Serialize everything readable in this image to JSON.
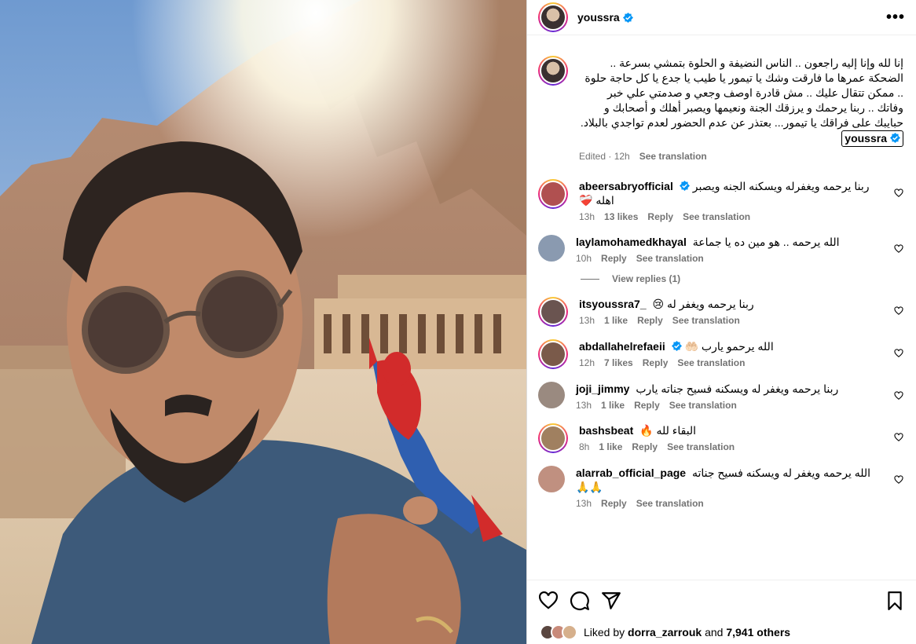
{
  "post": {
    "username": "youssra",
    "caption_username": "youssra",
    "caption_text": "إنا لله وإنا إليه راجعون .. الناس النضيفة و الحلوة بتمشي بسرعة .. الضحكة عمرها ما فارقت وشك يا تيمور يا طيب يا جدع يا كل حاجة حلوة .. ممكن تتقال عليك .. مش قادرة اوصف وجعي و صدمتي علي خبر وفاتك .. ربنا يرحمك و يرزقك الجنة ونعيمها ويصبر أهلك و أصحابك و حبايبك على فراقك يا تيمور... بعتذر عن عدم الحضور لعدم تواجدي بالبلاد.",
    "caption_time": "Edited · 12h",
    "see_translation": "See translation"
  },
  "comments": [
    {
      "user": "abeersabryofficial",
      "verified": true,
      "text": "ربنا يرحمه ويغفرله ويسكنه الجنه ويصبر اهله ❤️‍🩹",
      "time": "13h",
      "likes": "13 likes",
      "reply": "Reply",
      "translate": "See translation",
      "ring": true
    },
    {
      "user": "laylamohamedkhayal",
      "verified": false,
      "text": "الله يرحمه .. هو مين ده يا جماعة",
      "time": "10h",
      "likes": "",
      "reply": "Reply",
      "translate": "See translation",
      "ring": false
    },
    {
      "user": "itsyoussra7_",
      "verified": false,
      "text": "ربنا يرحمه ويغفر له 😢",
      "time": "13h",
      "likes": "1 like",
      "reply": "Reply",
      "translate": "See translation",
      "ring": true
    },
    {
      "user": "abdallahelrefaeii",
      "verified": true,
      "text": "الله يرحمو يارب 🤲🏻",
      "time": "12h",
      "likes": "7 likes",
      "reply": "Reply",
      "translate": "See translation",
      "ring": true
    },
    {
      "user": "joji_jimmy",
      "verified": false,
      "text": "ربنا يرحمه ويغفر له ويسكنه فسيح جناته يارب",
      "time": "13h",
      "likes": "1 like",
      "reply": "Reply",
      "translate": "See translation",
      "ring": false
    },
    {
      "user": "bashsbeat",
      "verified": false,
      "text": "البقاء لله 🔥",
      "time": "8h",
      "likes": "1 like",
      "reply": "Reply",
      "translate": "See translation",
      "ring": true
    },
    {
      "user": "alarrab_official_page",
      "verified": false,
      "text": "الله يرحمه ويغفر له ويسكنه فسيح جناته 🙏🙏",
      "time": "13h",
      "likes": "",
      "reply": "Reply",
      "translate": "See translation",
      "ring": false
    }
  ],
  "view_replies": "View replies (1)",
  "likes_line": {
    "prefix": "Liked by",
    "user": "dorra_zarrouk",
    "and": "and",
    "others": "7,941 others"
  },
  "icons": [
    "more-icon",
    "heart-icon",
    "comment-icon",
    "share-icon",
    "bookmark-icon",
    "verified-icon"
  ],
  "colors": {
    "verified": "#0095f6",
    "meta": "#737373",
    "border": "#dbdbdb"
  }
}
